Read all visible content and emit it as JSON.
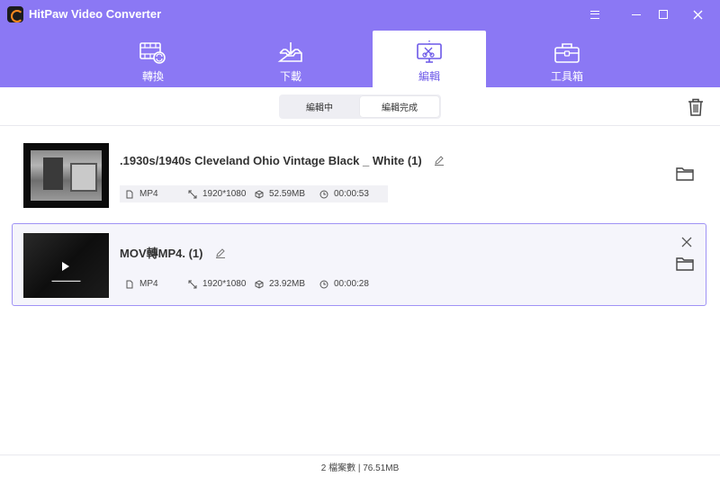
{
  "app": {
    "title": "HitPaw Video Converter"
  },
  "tabs": [
    {
      "label": "轉換",
      "icon": "film-convert-icon"
    },
    {
      "label": "下載",
      "icon": "download-tray-icon"
    },
    {
      "label": "編輯",
      "icon": "edit-screen-icon"
    },
    {
      "label": "工具箱",
      "icon": "toolbox-icon"
    }
  ],
  "subtabs": {
    "editing": "編輯中",
    "done": "編輯完成"
  },
  "files": [
    {
      "name": ".1930s/1940s Cleveland Ohio Vintage Black _ White (1)",
      "format": "MP4",
      "resolution": "1920*1080",
      "size": "52.59MB",
      "duration": "00:00:53"
    },
    {
      "name": "MOV轉MP4. (1)",
      "format": "MP4",
      "resolution": "1920*1080",
      "size": "23.92MB",
      "duration": "00:00:28"
    }
  ],
  "status": {
    "summary": "2 檔案數 | 76.51MB"
  },
  "colors": {
    "accent": "#8b78f4",
    "active_tab_text": "#6c58e8",
    "selected_border": "#9f92f5"
  }
}
